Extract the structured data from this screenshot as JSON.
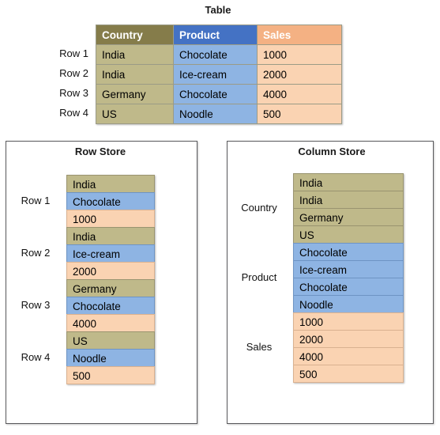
{
  "figure": {
    "table_title": "Table",
    "row_store_title": "Row Store",
    "column_store_title": "Column Store"
  },
  "palette": {
    "country_header": "#857C4A",
    "product_header": "#4472C4",
    "sales_header": "#F4B183",
    "country_cell": "#BFB98A",
    "product_cell": "#8EB4E3",
    "sales_cell": "#FAD3B2",
    "panel_border": "#59595C"
  },
  "table": {
    "headers": [
      "Country",
      "Product",
      "Sales"
    ],
    "row_labels": [
      "Row 1",
      "Row 2",
      "Row 3",
      "Row 4"
    ],
    "rows": [
      [
        "India",
        "Chocolate",
        "1000"
      ],
      [
        "India",
        "Ice-cream",
        "2000"
      ],
      [
        "Germany",
        "Chocolate",
        "4000"
      ],
      [
        "US",
        "Noodle",
        "500"
      ]
    ]
  },
  "row_store": {
    "group_labels": [
      "Row 1",
      "Row 2",
      "Row 3",
      "Row 4"
    ],
    "cells": [
      {
        "value": "India",
        "type": "country"
      },
      {
        "value": "Chocolate",
        "type": "product"
      },
      {
        "value": "1000",
        "type": "sales"
      },
      {
        "value": "India",
        "type": "country"
      },
      {
        "value": "Ice-cream",
        "type": "product"
      },
      {
        "value": "2000",
        "type": "sales"
      },
      {
        "value": "Germany",
        "type": "country"
      },
      {
        "value": "Chocolate",
        "type": "product"
      },
      {
        "value": "4000",
        "type": "sales"
      },
      {
        "value": "US",
        "type": "country"
      },
      {
        "value": "Noodle",
        "type": "product"
      },
      {
        "value": "500",
        "type": "sales"
      }
    ]
  },
  "column_store": {
    "group_labels": [
      "Country",
      "Product",
      "Sales"
    ],
    "cells": [
      {
        "value": "India",
        "type": "country"
      },
      {
        "value": "India",
        "type": "country"
      },
      {
        "value": "Germany",
        "type": "country"
      },
      {
        "value": "US",
        "type": "country"
      },
      {
        "value": "Chocolate",
        "type": "product"
      },
      {
        "value": "Ice-cream",
        "type": "product"
      },
      {
        "value": "Chocolate",
        "type": "product"
      },
      {
        "value": "Noodle",
        "type": "product"
      },
      {
        "value": "1000",
        "type": "sales"
      },
      {
        "value": "2000",
        "type": "sales"
      },
      {
        "value": "4000",
        "type": "sales"
      },
      {
        "value": "500",
        "type": "sales"
      }
    ]
  }
}
